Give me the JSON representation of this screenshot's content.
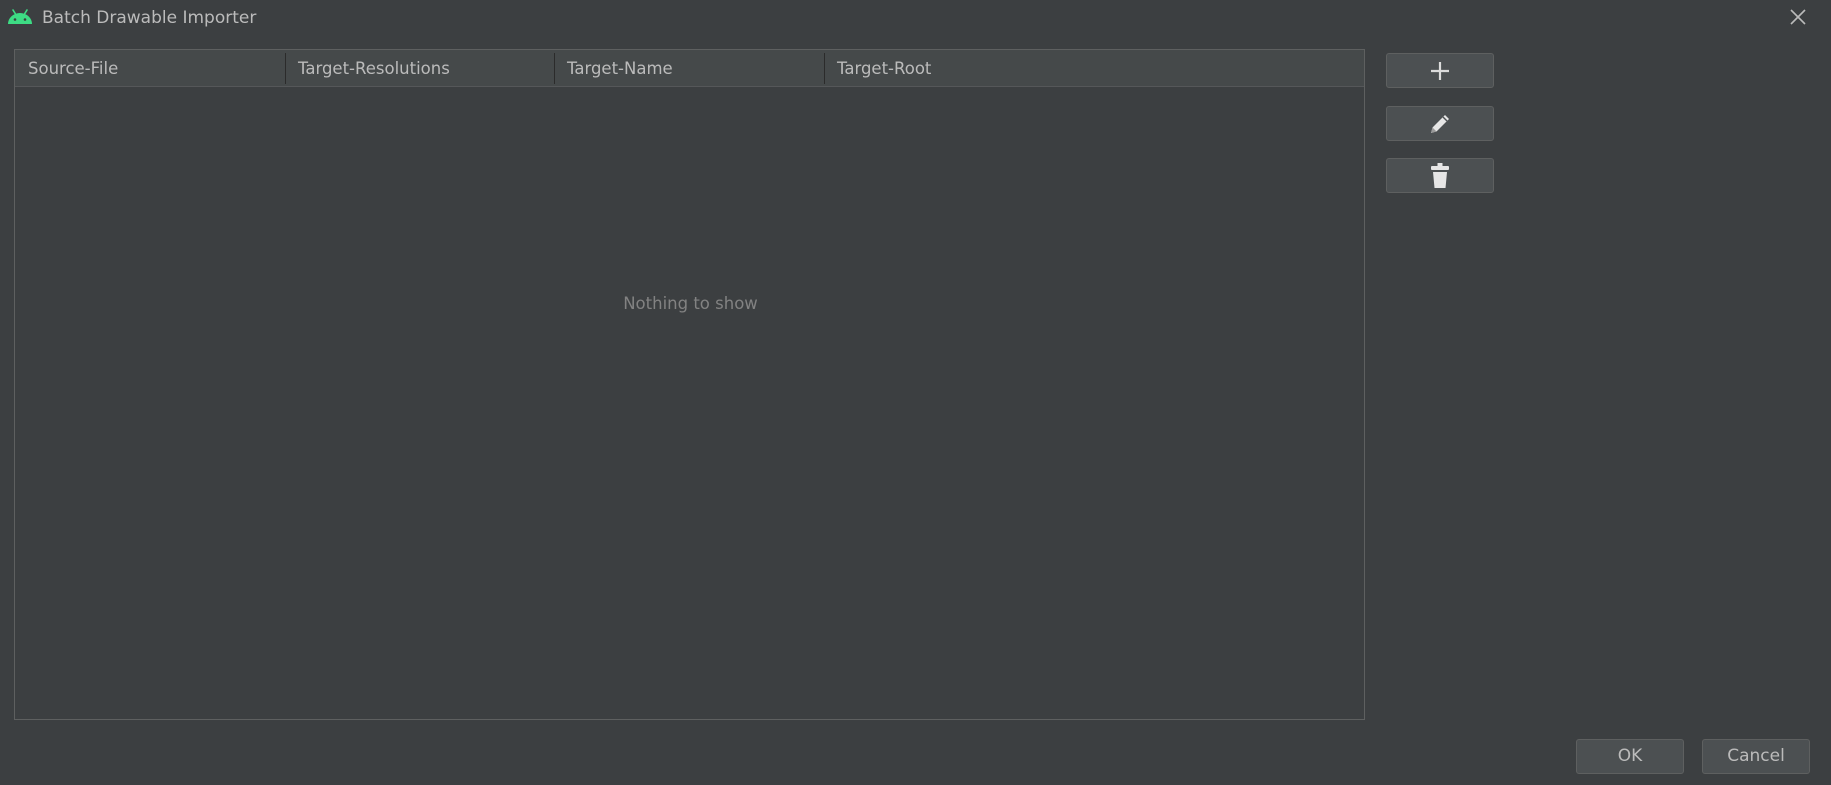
{
  "window": {
    "title": "Batch Drawable Importer",
    "app_icon": "android-icon",
    "close_icon": "close-icon"
  },
  "table": {
    "columns": [
      "Source-File",
      "Target-Resolutions",
      "Target-Name",
      "Target-Root"
    ],
    "rows": [],
    "empty_text": "Nothing to show"
  },
  "side_buttons": {
    "add_icon": "plus-icon",
    "edit_icon": "pencil-icon",
    "delete_icon": "trash-icon"
  },
  "footer": {
    "ok_label": "OK",
    "cancel_label": "Cancel"
  },
  "colors": {
    "background": "#3c3f41",
    "header": "#45494a",
    "button": "#4c5052",
    "text": "#bbbbbb",
    "android_green": "#3ddc84"
  }
}
